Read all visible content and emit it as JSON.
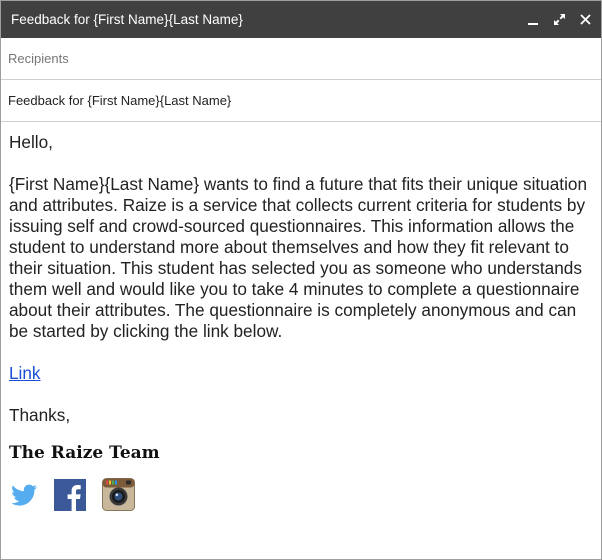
{
  "window": {
    "title": "Feedback for {First Name}{Last Name}",
    "controls": [
      "minimize-icon",
      "expand-icon",
      "close-icon"
    ]
  },
  "fields": {
    "recipients_placeholder": "Recipients",
    "subject_value": "Feedback for {First Name}{Last Name}"
  },
  "message": {
    "greeting": "Hello,",
    "paragraph": "{First Name}{Last Name} wants to find a future that fits their unique situation and attributes. Raize is a service that collects current criteria for students by issuing self and crowd-sourced questionnaires. This information allows the student to understand more about themselves and how they fit relevant to their situation. This student has selected you as someone who understands them well and would like you to take 4 minutes to complete a questionnaire about their attributes. The questionnaire is completely anonymous and can be started by clicking the link below.",
    "link_text": "Link",
    "closing": "Thanks,",
    "signature": "The Raize Team"
  },
  "social_icons": [
    "twitter-icon",
    "facebook-icon",
    "instagram-icon"
  ],
  "colors": {
    "titlebar": "#404040",
    "link": "#1a4fd6",
    "twitter": "#55acee",
    "facebook": "#3b5998"
  }
}
